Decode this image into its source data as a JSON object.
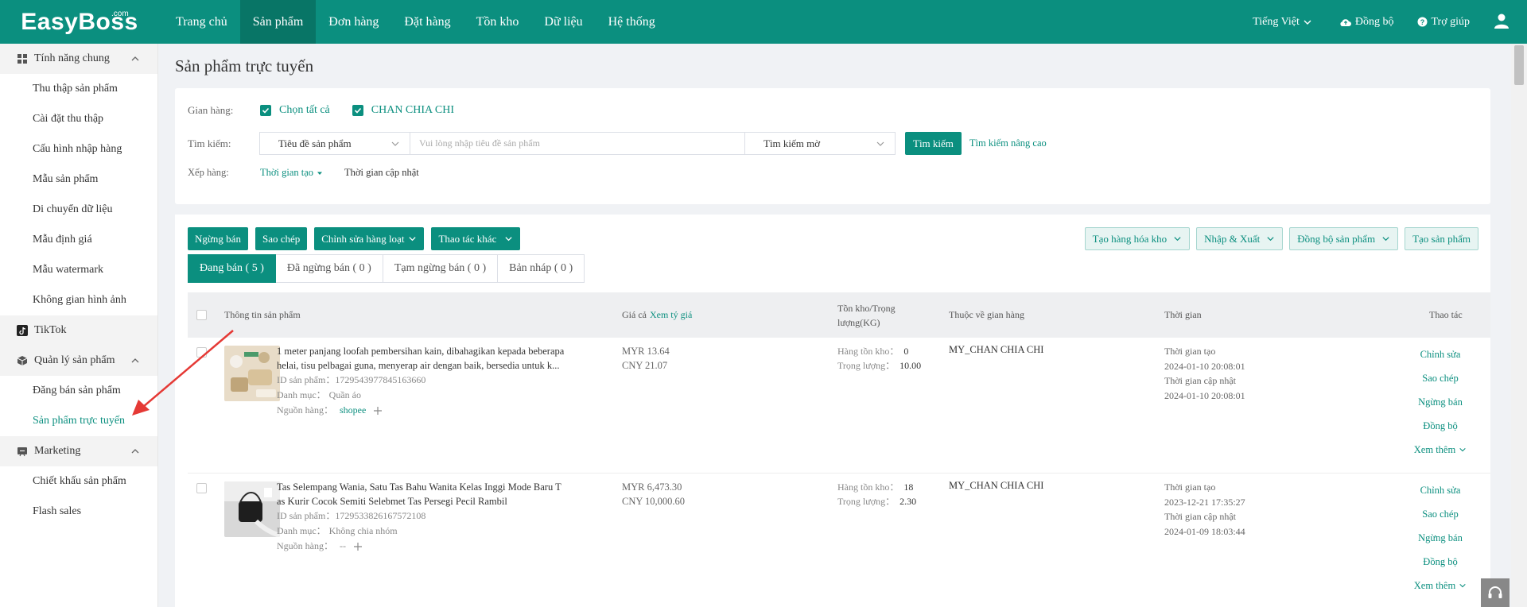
{
  "brand": {
    "logo": "EasyBoss",
    "logo_suffix": ".com"
  },
  "topnav": [
    "Trang chủ",
    "Sản phẩm",
    "Đơn hàng",
    "Đặt hàng",
    "Tồn kho",
    "Dữ liệu",
    "Hệ thống"
  ],
  "topright": {
    "language": "Tiếng Việt",
    "sync": "Đồng bộ",
    "help": "Trợ giúp"
  },
  "sidebar": {
    "groups": [
      {
        "label": "Tính năng chung",
        "items": [
          "Thu thập sản phẩm",
          "Cài đặt thu thập",
          "Cấu hình nhập hàng",
          "Mẫu sản phẩm",
          "Di chuyển dữ liệu",
          "Mẫu định giá",
          "Mẫu watermark",
          "Không gian hình ảnh"
        ]
      },
      {
        "label": "TikTok",
        "items": []
      },
      {
        "label": "Quản lý sản phẩm",
        "items": [
          "Đăng bán sản phẩm",
          "Sản phẩm trực tuyến"
        ]
      },
      {
        "label": "Marketing",
        "items": [
          "Chiết khấu sản phẩm",
          "Flash sales"
        ]
      }
    ]
  },
  "page": {
    "title": "Sản phẩm trực tuyến"
  },
  "filter": {
    "store_label": "Gian hàng:",
    "select_all": "Chọn tất cả",
    "store_name": "CHAN CHIA CHI",
    "search_label": "Tìm kiếm:",
    "search_field": "Tiêu đề sản phẩm",
    "search_placeholder": "Vui lòng nhập tiêu đề sản phẩm",
    "search_mode": "Tìm kiếm mờ",
    "search_button": "Tìm kiếm",
    "advanced_search": "Tìm kiếm nâng cao",
    "sort_label": "Xếp hàng:",
    "sort_created": "Thời gian tạo",
    "sort_updated": "Thời gian cập nhật"
  },
  "actions": {
    "stop_selling": "Ngừng bán",
    "copy": "Sao chép",
    "bulk_edit": "Chỉnh sửa hàng loạt",
    "other_actions": "Thao tác khác",
    "create_goods": "Tạo hàng hóa kho",
    "import_export": "Nhập & Xuất",
    "sync_products": "Đồng bộ sản phẩm",
    "create_product": "Tạo sản phẩm"
  },
  "tabs": [
    "Đang bán ( 5 )",
    "Đã ngừng bán ( 0 )",
    "Tạm ngừng bán ( 0 )",
    "Bản nháp ( 0 )"
  ],
  "table": {
    "headers": {
      "product": "Thông tin sản phẩm",
      "price": "Giá cả",
      "price_link": "Xem tỷ giá",
      "stock_line1": "Tồn kho/Trọng",
      "stock_line2": "lượng(KG)",
      "store": "Thuộc về gian hàng",
      "time": "Thời gian",
      "ops": "Thao tác"
    },
    "labels": {
      "id": "ID sản phẩm：",
      "category": "Danh mục：",
      "source": "Nguồn hàng：",
      "stock": "Hàng tồn kho：",
      "weight": "Trọng lượng：",
      "created": "Thời gian tạo",
      "updated": "Thời gian cập nhật"
    },
    "ops": [
      "Chỉnh sửa",
      "Sao chép",
      "Ngừng bán",
      "Đồng bộ",
      "Xem thêm"
    ],
    "rows": [
      {
        "title_l1": "1 meter panjang loofah pembersihan kain, dibahagikan kepada beberapa",
        "title_l2": "helai, tisu pelbagai guna, menyerap air dengan baik, bersedia untuk k...",
        "id": "1729543977845163660",
        "category": "Quần áo",
        "source": "shopee",
        "price_myr": "MYR 13.64",
        "price_cny": "CNY 21.07",
        "stock": "0",
        "weight": "10.00",
        "store": "MY_CHAN CHIA CHI",
        "created": "2024-01-10 20:08:01",
        "updated": "2024-01-10 20:08:01"
      },
      {
        "title_l1": "Tas Selempang Wania, Satu Tas Bahu Wanita Kelas Inggi Mode Baru T",
        "title_l2": "as Kurir Cocok Semiti Selebmet Tas Persegi Pecil Rambil",
        "id": "1729533826167572108",
        "category": "Không chia nhóm",
        "source": "--",
        "price_myr": "MYR 6,473.30",
        "price_cny": "CNY 10,000.60",
        "stock": "18",
        "weight": "2.30",
        "store": "MY_CHAN CHIA CHI",
        "created": "2023-12-21 17:35:27",
        "updated": "2024-01-09 18:03:44"
      }
    ]
  },
  "colors": {
    "brand": "#0b8f7f",
    "annotation_arrow": "#e53935"
  }
}
